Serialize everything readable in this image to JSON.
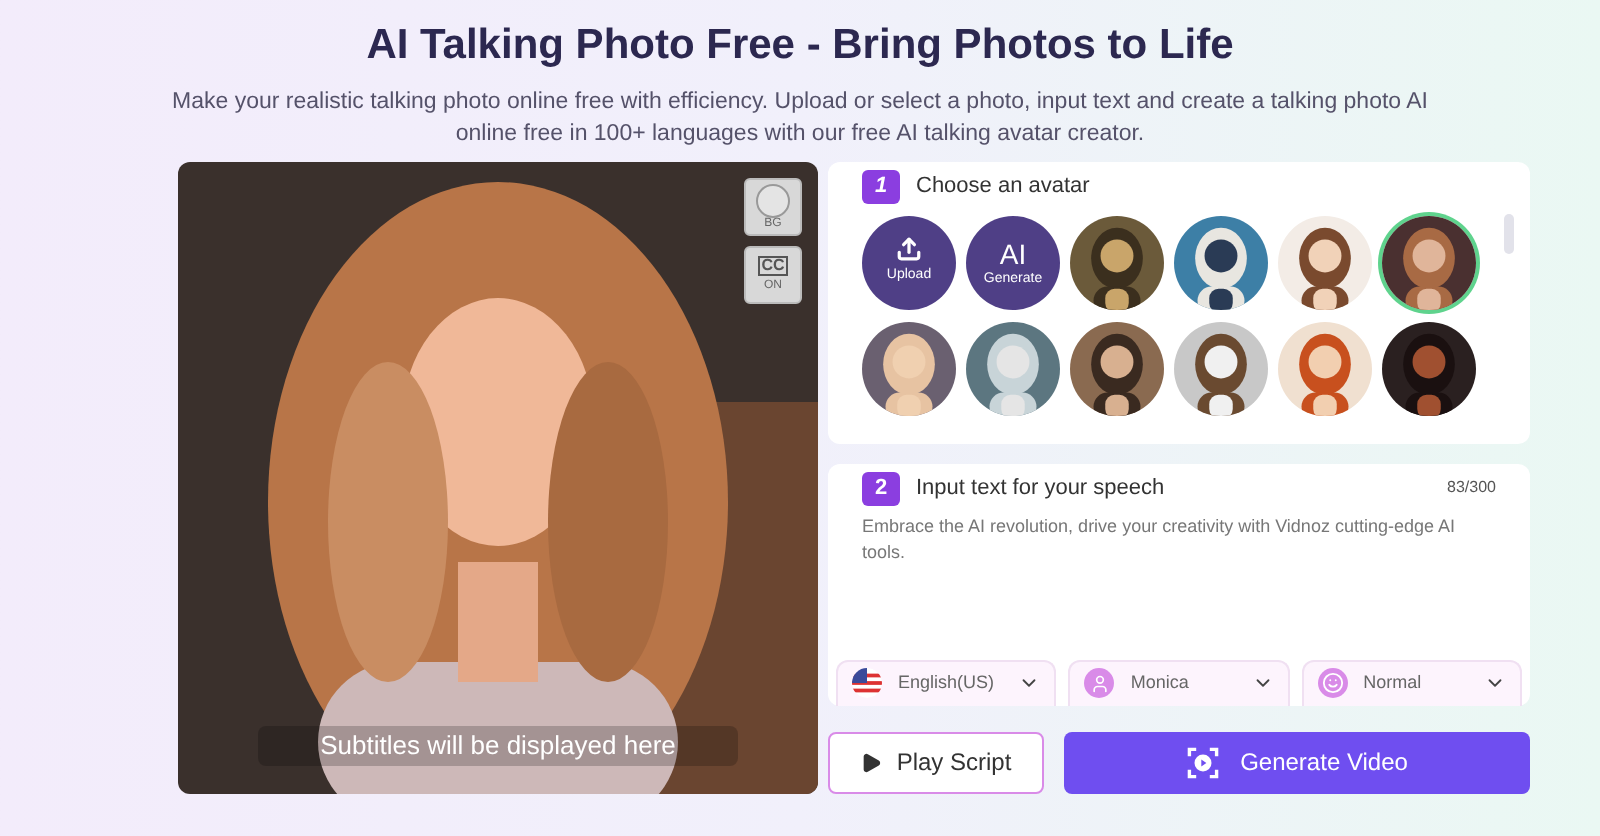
{
  "header": {
    "title": "AI Talking Photo Free - Bring Photos to Life",
    "subtitle": "Make your realistic talking photo online free with efficiency. Upload or select a photo, input text and create a talking photo AI online free in 100+ languages with our free AI talking avatar creator."
  },
  "preview": {
    "bg_label": "BG",
    "cc_label": "CC",
    "cc_state": "ON",
    "subtitle": "Subtitles will be displayed here"
  },
  "step1": {
    "number": "1",
    "title": "Choose an avatar",
    "avatars": [
      {
        "kind": "upload",
        "label": "Upload",
        "selected": false
      },
      {
        "kind": "generate",
        "glyph": "AI",
        "label": "Generate",
        "selected": false
      },
      {
        "kind": "picture",
        "selected": false
      },
      {
        "kind": "picture",
        "selected": false
      },
      {
        "kind": "picture",
        "selected": false
      },
      {
        "kind": "picture",
        "selected": true
      },
      {
        "kind": "picture",
        "selected": false
      },
      {
        "kind": "picture",
        "selected": false
      },
      {
        "kind": "picture",
        "selected": false
      },
      {
        "kind": "picture",
        "selected": false
      },
      {
        "kind": "picture",
        "selected": false
      },
      {
        "kind": "picture",
        "selected": false
      }
    ]
  },
  "step2": {
    "number": "2",
    "title": "Input text for your speech",
    "count": "83/300",
    "text": "Embrace the AI revolution, drive your creativity with Vidnoz cutting-edge AI tools.",
    "selects": [
      {
        "kind": "flag",
        "value": "English(US)"
      },
      {
        "kind": "person",
        "value": "Monica"
      },
      {
        "kind": "smile",
        "value": "Normal"
      }
    ]
  },
  "buttons": {
    "play": "Play Script",
    "generate": "Generate Video"
  }
}
